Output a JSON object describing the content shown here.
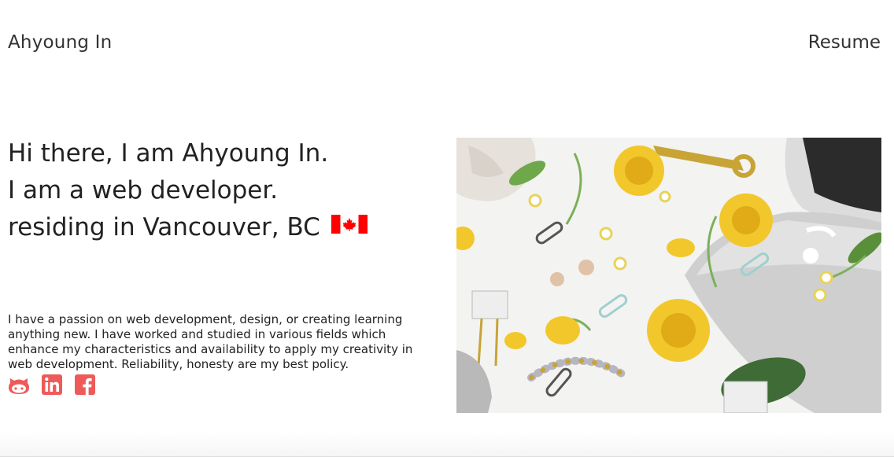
{
  "nav": {
    "brand": "Ahyoung In",
    "resume_label": "Resume"
  },
  "hero": {
    "lines": [
      "Hi there, I am Ahyoung In.",
      "I am a web developer.",
      "residing in Vancouver, BC"
    ],
    "flag_icon": "canada-flag-icon"
  },
  "bio": "I have a passion on web development, design, or creating learning anything new. I have worked and studied in various fields which enhance my characteristics and availability to apply my creativity in web development. Reliability, honesty are my best policy.",
  "social": [
    {
      "icon": "github-icon"
    },
    {
      "icon": "linkedin-icon"
    },
    {
      "icon": "facebook-icon"
    }
  ],
  "colors": {
    "accent": "#ee5a5a",
    "flag_red": "#ff0000"
  },
  "photo_icon": "desk-flatlay-photo"
}
